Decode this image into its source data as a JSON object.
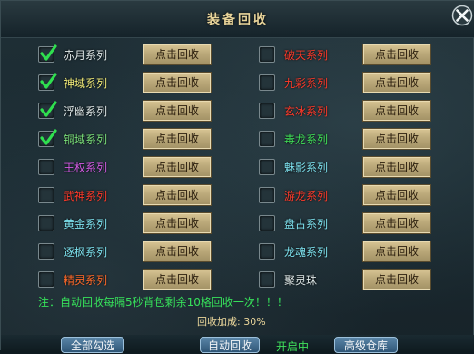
{
  "title": "装备回收",
  "button_label": "点击回收",
  "left_column": [
    {
      "label": "赤月系列",
      "checked": true,
      "color": "#dfe8e8"
    },
    {
      "label": "神域系列",
      "checked": true,
      "color": "#f0ea78"
    },
    {
      "label": "浮幽系列",
      "checked": true,
      "color": "#dfe8e8"
    },
    {
      "label": "铜域系列",
      "checked": true,
      "color": "#7be07a"
    },
    {
      "label": "王权系列",
      "checked": false,
      "color": "#d55be6"
    },
    {
      "label": "武神系列",
      "checked": false,
      "color": "#ff3a2a"
    },
    {
      "label": "黄金系列",
      "checked": false,
      "color": "#7ee3f0"
    },
    {
      "label": "逐枫系列",
      "checked": false,
      "color": "#7ee3f0"
    },
    {
      "label": "精灵系列",
      "checked": false,
      "color": "#ff6a2a"
    }
  ],
  "right_column": [
    {
      "label": "破天系列",
      "checked": false,
      "color": "#ff3a2a"
    },
    {
      "label": "九彩系列",
      "checked": false,
      "color": "#ff3a2a"
    },
    {
      "label": "玄冰系列",
      "checked": false,
      "color": "#ff3a2a"
    },
    {
      "label": "毒龙系列",
      "checked": false,
      "color": "#41e35a"
    },
    {
      "label": "魅影系列",
      "checked": false,
      "color": "#7ee3f0"
    },
    {
      "label": "游龙系列",
      "checked": false,
      "color": "#ff3a2a"
    },
    {
      "label": "盘古系列",
      "checked": false,
      "color": "#7ee3f0"
    },
    {
      "label": "龙魂系列",
      "checked": false,
      "color": "#7ee3f0"
    },
    {
      "label": "聚灵珠",
      "checked": false,
      "color": "#dfe8e8"
    }
  ],
  "note": "注：自动回收每隔5秒背包剩余10格回收一次！！！",
  "recycle_rate": "回收加成: 30%",
  "bottom": {
    "select_all": "全部勾选",
    "auto_recycle": "自动回收",
    "status": "开启中",
    "warehouse": "高级仓库"
  }
}
